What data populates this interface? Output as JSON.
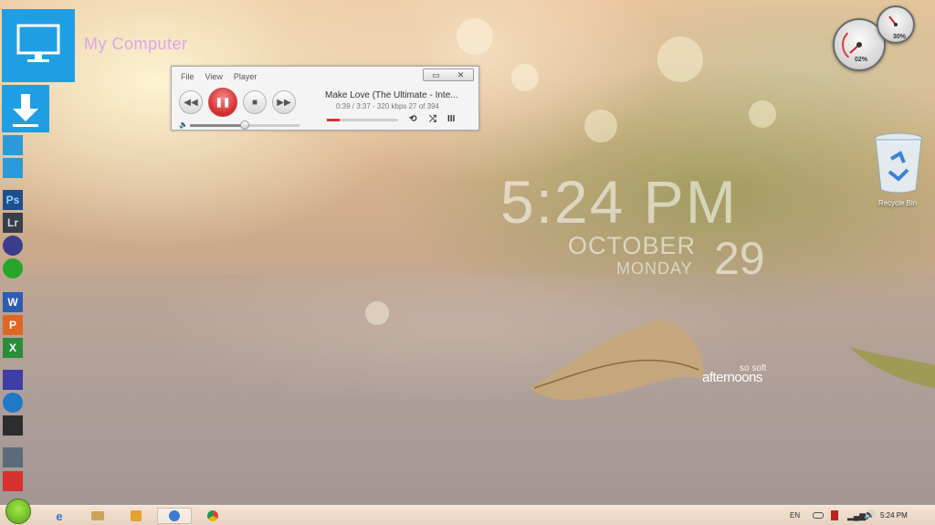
{
  "desktop": {
    "my_computer_label": "My Computer",
    "clock": {
      "time": "5:24 PM",
      "month": "OCTOBER",
      "weekday": "MONDAY",
      "date": "29"
    },
    "watermark": {
      "line1": "so soft",
      "line2": "afternoons"
    },
    "recycle_bin_label": "Recycle Bin"
  },
  "side_icons": [
    {
      "name": "folder-icon",
      "label": ""
    },
    {
      "name": "folder-icon",
      "label": ""
    },
    {
      "name": "photoshop-icon",
      "label": "Ps"
    },
    {
      "name": "lightroom-icon",
      "label": "Lr"
    },
    {
      "name": "disc-burner-icon",
      "label": ""
    },
    {
      "name": "media-reel-icon",
      "label": ""
    },
    {
      "name": "word-icon",
      "label": "W"
    },
    {
      "name": "powerpoint-icon",
      "label": "P"
    },
    {
      "name": "excel-icon",
      "label": "X"
    },
    {
      "name": "paint-icon",
      "label": ""
    },
    {
      "name": "settings-wheel-icon",
      "label": ""
    },
    {
      "name": "shield-icon",
      "label": ""
    },
    {
      "name": "tools-icon",
      "label": ""
    },
    {
      "name": "trash-icon",
      "label": ""
    }
  ],
  "player": {
    "menu": [
      "File",
      "View",
      "Player"
    ],
    "track_title": "Make Love (The Ultimate - Inte...",
    "track_info": "0:39 / 3:37 - 320 kbps   27 of 394",
    "seek_progress": 0.18,
    "volume": 0.5
  },
  "gauges": {
    "cpu_label": "02%",
    "ram_label": "30%"
  },
  "taskbar": {
    "language": "EN",
    "time": "5:24 PM",
    "items": [
      "ie-icon",
      "explorer-icon",
      "media-icon",
      "player-icon",
      "chrome-icon"
    ]
  },
  "colors": {
    "tile_blue": "#1f9fe3",
    "accent_red": "#d42b2b"
  }
}
